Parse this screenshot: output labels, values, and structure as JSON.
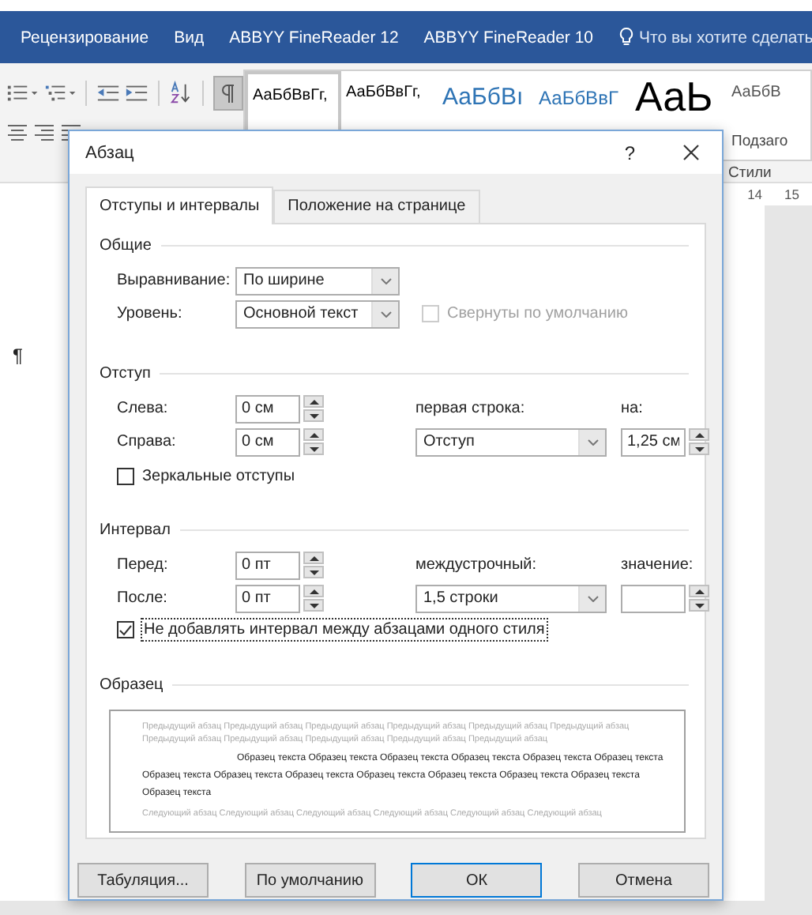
{
  "ribbon_tabs": [
    {
      "label": "Рецензирование"
    },
    {
      "label": "Вид"
    },
    {
      "label": "ABBYY FineReader 12"
    },
    {
      "label": "ABBYY FineReader 10"
    }
  ],
  "tell_me": {
    "placeholder": "Что вы хотите сделать"
  },
  "show_marks": {
    "selected": true
  },
  "style_gallery": {
    "items": [
      {
        "sample": "АаБбВвГг,",
        "kind": "normal",
        "selected": true
      },
      {
        "sample": "АаБбВвГг,",
        "kind": "normal",
        "selected": false
      },
      {
        "sample": "АаБбВı",
        "kind": "heading",
        "selected": false
      },
      {
        "sample": "АаБбВвГ",
        "kind": "heading2",
        "selected": false
      },
      {
        "sample": "АаЬ",
        "kind": "title",
        "selected": false
      },
      {
        "sample": "АаБбВ",
        "kind": "subtitle",
        "selected": false,
        "name": "Подзаго"
      }
    ],
    "group_label": "Стили"
  },
  "ruler": {
    "ticks": [
      "14",
      "15"
    ]
  },
  "page": {
    "mark": "¶"
  },
  "dialog": {
    "title": "Абзац",
    "help": "?",
    "tabs": [
      {
        "label": "Отступы и интервалы",
        "selected": true
      },
      {
        "label": "Положение на странице",
        "selected": false
      }
    ],
    "general": {
      "heading": "Общие",
      "alignment_label": "Выравнивание:",
      "alignment": "По ширине",
      "level_label": "Уровень:",
      "level_value": "Основной текст",
      "collapsed": {
        "label": "Свернуты по умолчанию",
        "checked": false,
        "disabled": true,
        "focused": false
      }
    },
    "indent": {
      "heading": "Отступ",
      "left_label": "Слева:",
      "left": "0 см",
      "right_label": "Справа:",
      "right": "0 см",
      "first_line_label": "первая строка:",
      "first_line": "Отступ",
      "by_label": "на:",
      "by": "1,25 см",
      "mirror": {
        "label": "Зеркальные отступы",
        "checked": false,
        "disabled": false,
        "focused": false
      }
    },
    "spacing": {
      "heading": "Интервал",
      "before_label": "Перед:",
      "before": "0 пт",
      "after_label": "После:",
      "after": "0 пт",
      "line_label": "междустрочный:",
      "line": "1,5 строки",
      "value_label": "значение:",
      "no_space": {
        "label": "Не добавлять интервал между абзацами одного стиля",
        "checked": true,
        "disabled": false,
        "focused": true
      }
    },
    "preview": {
      "heading": "Образец",
      "paragraphs": [
        {
          "kind": "previous",
          "text": "Предыдущий абзац Предыдущий абзац Предыдущий абзац Предыдущий абзац Предыдущий абзац Предыдущий абзац Предыдущий абзац Предыдущий абзац Предыдущий абзац Предыдущий абзац Предыдущий абзац"
        },
        {
          "kind": "sample",
          "text": "Образец текста Образец текста Образец текста Образец текста Образец текста Образец текста Образец текста Образец текста Образец текста Образец текста Образец текста Образец текста Образец текста Образец текста"
        },
        {
          "kind": "next",
          "text": "Следующий абзац Следующий абзац Следующий абзац Следующий абзац Следующий абзац Следующий абзац"
        }
      ]
    },
    "buttons": [
      {
        "label": "Табуляция...",
        "kind": "normal"
      },
      {
        "label": "По умолчанию",
        "kind": "normal"
      },
      {
        "label": "ОК",
        "kind": "default"
      },
      {
        "label": "Отмена",
        "kind": "normal"
      }
    ]
  }
}
